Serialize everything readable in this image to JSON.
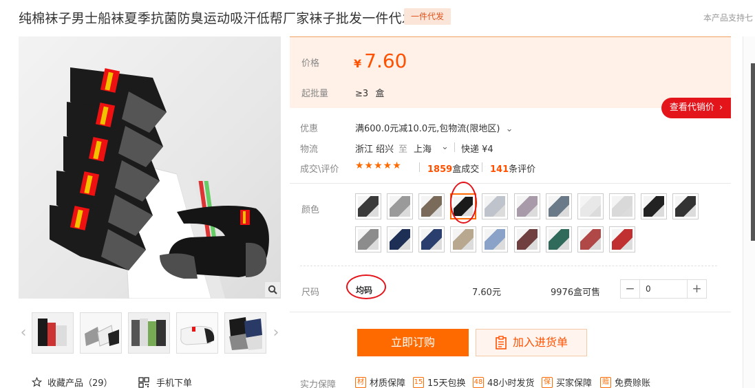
{
  "title": "纯棉袜子男士船袜夏季抗菌防臭运动吸汗低帮厂家袜子批发一件代发",
  "badge": "一件代发",
  "support_text": "本产品支持七",
  "price": {
    "label": "价格",
    "currency": "¥",
    "value": "7.60",
    "moq_label": "起批量",
    "moq_value": "≥3",
    "moq_unit": "盒",
    "agent_price_button": "查看代销价"
  },
  "promo": {
    "label": "优惠",
    "text": "满600.0元减10.0元,包物流(限地区)"
  },
  "logistics": {
    "label": "物流",
    "from": "浙江 绍兴",
    "to_word": "至",
    "to": "上海",
    "method": "快递 ¥4"
  },
  "deals": {
    "label": "成交\\评价",
    "stars": "★★★★★",
    "sold_count": "1859",
    "sold_suffix": "盒成交",
    "review_count": "141",
    "review_suffix": "条评价"
  },
  "color": {
    "label": "颜色",
    "selected_index": 3,
    "swatches": [
      {
        "name": "swatch-1",
        "color": "#3a3a3a"
      },
      {
        "name": "swatch-2",
        "color": "#9a9a9a"
      },
      {
        "name": "swatch-3",
        "color": "#7a6a5a"
      },
      {
        "name": "swatch-4",
        "color": "#1a1a1a"
      },
      {
        "name": "swatch-5",
        "color": "#bfc4cc"
      },
      {
        "name": "swatch-6",
        "color": "#a89aa8"
      },
      {
        "name": "swatch-7",
        "color": "#6a7a88"
      },
      {
        "name": "swatch-8",
        "color": "#e8e8e8"
      },
      {
        "name": "swatch-9",
        "color": "#d9d9d9"
      },
      {
        "name": "swatch-10",
        "color": "#222222"
      },
      {
        "name": "swatch-11",
        "color": "#333333"
      },
      {
        "name": "swatch-12",
        "color": "#8c8c8c"
      },
      {
        "name": "swatch-13",
        "color": "#1e2f55"
      },
      {
        "name": "swatch-14",
        "color": "#2b3f6e"
      },
      {
        "name": "swatch-15",
        "color": "#b8a890"
      },
      {
        "name": "swatch-16",
        "color": "#8aa2c8"
      },
      {
        "name": "swatch-17",
        "color": "#704040"
      },
      {
        "name": "swatch-18",
        "color": "#2f6a5a"
      },
      {
        "name": "swatch-19",
        "color": "#b04848"
      },
      {
        "name": "swatch-20",
        "color": "#c03030"
      }
    ]
  },
  "size": {
    "label": "尺码",
    "value": "均码",
    "price": "7.60元",
    "stock": "9976盒可售",
    "qty": "0",
    "minus": "−",
    "plus": "+"
  },
  "actions": {
    "buy": "立即订购",
    "cart": "加入进货单"
  },
  "guarantee": {
    "label": "实力保障",
    "items": [
      {
        "icon": "材",
        "text": "材质保障"
      },
      {
        "icon": "15",
        "text": "15天包换"
      },
      {
        "icon": "48",
        "text": "48小时发货"
      },
      {
        "icon": "保",
        "text": "买家保障"
      },
      {
        "icon": "赔",
        "text": "免费赊账"
      }
    ]
  },
  "left_links": {
    "favorite": "收藏产品（29）",
    "mobile_order": "手机下单"
  },
  "colors": {
    "accent": "#ff5000",
    "buy_button": "#ff6a00",
    "agent_button": "#e4141b",
    "price_bg": "#fff1e8"
  }
}
